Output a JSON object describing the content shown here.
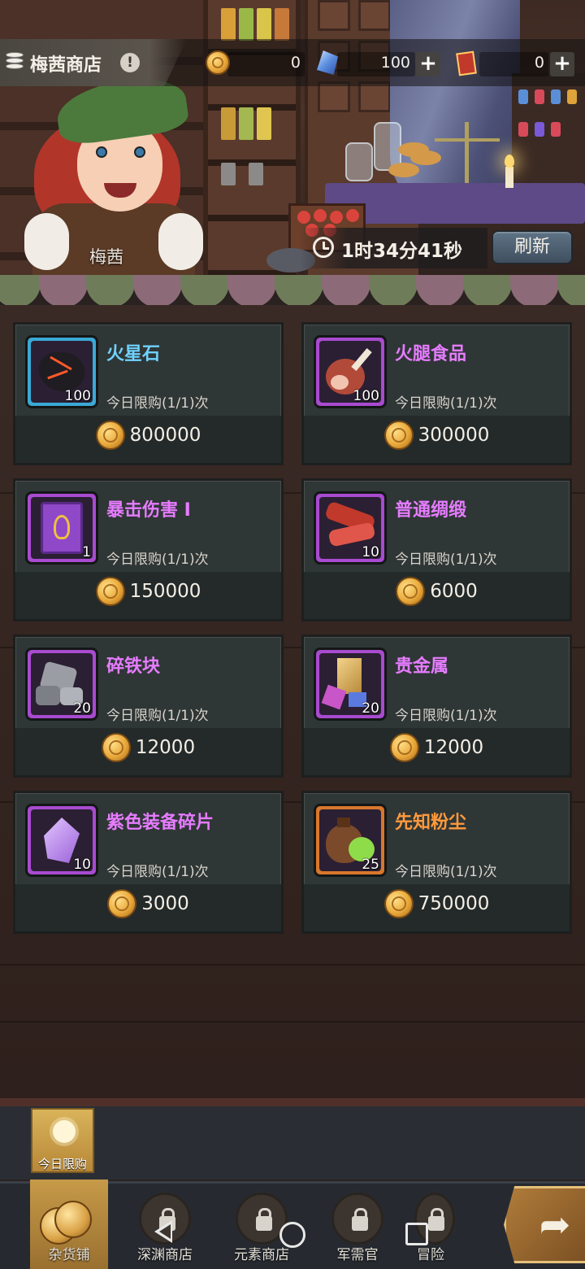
{
  "header": {
    "shop_title": "梅茜商店",
    "info_symbol": "!",
    "resources": [
      {
        "name": "gold-coin",
        "value": "0"
      },
      {
        "name": "blue-crystal",
        "value": "100"
      },
      {
        "name": "red-ticket",
        "value": "0"
      }
    ],
    "plus_symbol": "+"
  },
  "scene": {
    "npc_name": "梅茜",
    "timer": "1时34分41秒",
    "refresh_label": "刷新"
  },
  "items": [
    {
      "name": "火星石",
      "qty": "100",
      "limit": "今日限购(1/1)次",
      "price": "800000",
      "name_color": "#6fd2ff",
      "frame_color": "#3aa9d6",
      "icon": "magma-stone-icon"
    },
    {
      "name": "火腿食品",
      "qty": "100",
      "limit": "今日限购(1/1)次",
      "price": "300000",
      "name_color": "#e67cff",
      "frame_color": "#a84bd0",
      "icon": "ham-icon"
    },
    {
      "name": "暴击伤害 I",
      "qty": "1",
      "limit": "今日限购(1/1)次",
      "price": "150000",
      "name_color": "#e67cff",
      "frame_color": "#a84bd0",
      "icon": "spellbook-icon"
    },
    {
      "name": "普通绸缎",
      "qty": "10",
      "limit": "今日限购(1/1)次",
      "price": "6000",
      "name_color": "#e67cff",
      "frame_color": "#a84bd0",
      "icon": "silk-icon"
    },
    {
      "name": "碎铁块",
      "qty": "20",
      "limit": "今日限购(1/1)次",
      "price": "12000",
      "name_color": "#e67cff",
      "frame_color": "#a84bd0",
      "icon": "iron-chunk-icon"
    },
    {
      "name": "贵金属",
      "qty": "20",
      "limit": "今日限购(1/1)次",
      "price": "12000",
      "name_color": "#e67cff",
      "frame_color": "#a84bd0",
      "icon": "precious-metal-icon"
    },
    {
      "name": "紫色装备碎片",
      "qty": "10",
      "limit": "今日限购(1/1)次",
      "price": "3000",
      "name_color": "#e67cff",
      "frame_color": "#a84bd0",
      "icon": "purple-shard-icon"
    },
    {
      "name": "先知粉尘",
      "qty": "25",
      "limit": "今日限购(1/1)次",
      "price": "750000",
      "name_color": "#ff9a3c",
      "frame_color": "#d8772c",
      "icon": "prophet-dust-icon"
    }
  ],
  "sub_tabs": [
    {
      "label": "今日限购"
    }
  ],
  "nav": [
    {
      "label": "杂货铺",
      "active": true
    },
    {
      "label": "深渊商店",
      "active": false
    },
    {
      "label": "元素商店",
      "active": false
    },
    {
      "label": "军需官",
      "active": false
    },
    {
      "label": "冒险",
      "active": false
    }
  ],
  "go_arrow": "➦"
}
